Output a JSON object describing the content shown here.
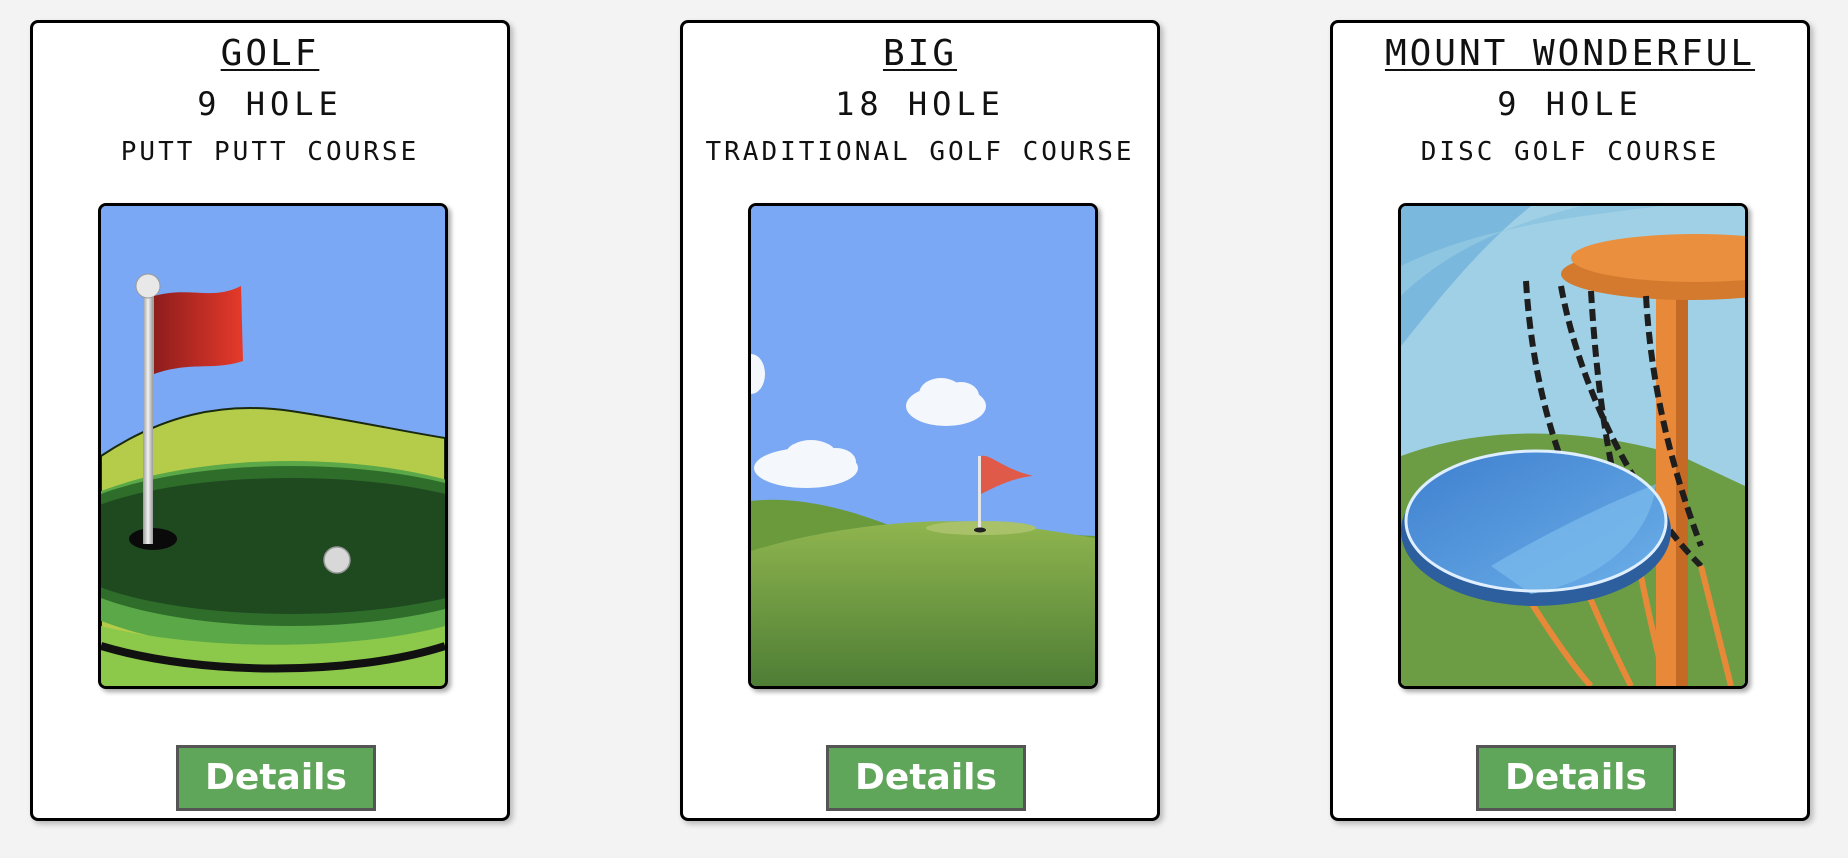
{
  "cards": [
    {
      "title": "GOLF",
      "holes": "9 HOLE",
      "type": "PUTT PUTT COURSE",
      "button_label": "Details",
      "image_icon": "putt-putt-flag-illustration"
    },
    {
      "title": "BIG",
      "holes": "18 HOLE",
      "type": "TRADITIONAL GOLF COURSE",
      "button_label": "Details",
      "image_icon": "golf-course-landscape-illustration"
    },
    {
      "title": "MOUNT WONDERFUL",
      "holes": "9 HOLE",
      "type": "DISC GOLF COURSE",
      "button_label": "Details",
      "image_icon": "disc-golf-basket-illustration"
    }
  ],
  "colors": {
    "button": "#5fa65a",
    "sky": "#7ba8f5",
    "grass": "#8fbf4a"
  }
}
